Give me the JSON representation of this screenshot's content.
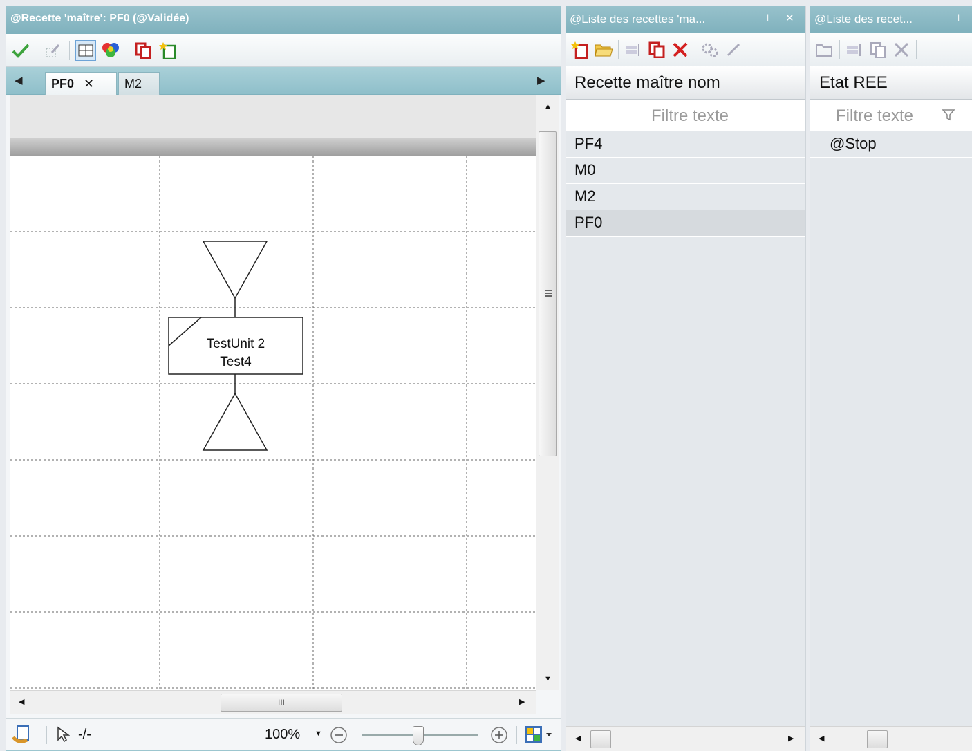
{
  "editor": {
    "title": "@Recette 'maître': PF0 (@Validée)",
    "tabs": [
      {
        "label": "PF0",
        "close": "✕"
      },
      {
        "label": "M2"
      }
    ],
    "diagram": {
      "step_line1": "TestUnit 2",
      "step_line2": "Test4"
    },
    "hscroll_grip": "III",
    "status": {
      "pointer_text": "-/-",
      "zoom": "100%"
    }
  },
  "list1": {
    "title": "@Liste des recettes 'ma...",
    "pin": "⊥",
    "close": "✕",
    "column": "Recette maître nom",
    "filter_placeholder": "Filtre texte",
    "rows": [
      "PF4",
      "M0",
      "M2",
      "PF0"
    ]
  },
  "list2": {
    "title": "@Liste des recet...",
    "pin": "⊥",
    "column": "Etat REE",
    "filter_placeholder": "Filtre texte",
    "rows": [
      "@Stop"
    ]
  },
  "colors": {
    "titlebar": "#8dbbc6",
    "accept_green": "#3da33d",
    "delete_red": "#d42020"
  }
}
